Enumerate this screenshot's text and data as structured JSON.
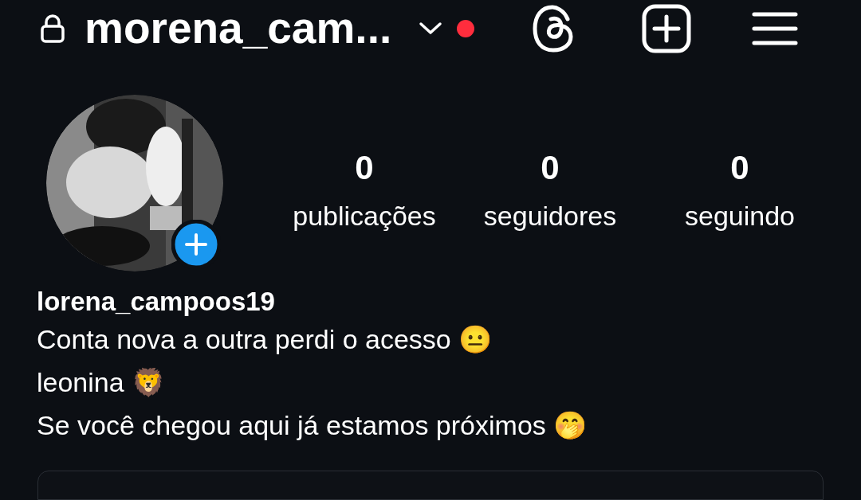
{
  "header": {
    "username": "morena_cam...",
    "notification_dot": true
  },
  "profile": {
    "stats": [
      {
        "value": "0",
        "label": "publicações"
      },
      {
        "value": "0",
        "label": "seguidores"
      },
      {
        "value": "0",
        "label": "seguindo"
      }
    ],
    "name": "lorena_campoos19",
    "bio": [
      "Conta nova a outra perdi o acesso 😐",
      "leonina 🦁",
      "Se você chegou aqui já estamos próximos 🤭"
    ]
  }
}
